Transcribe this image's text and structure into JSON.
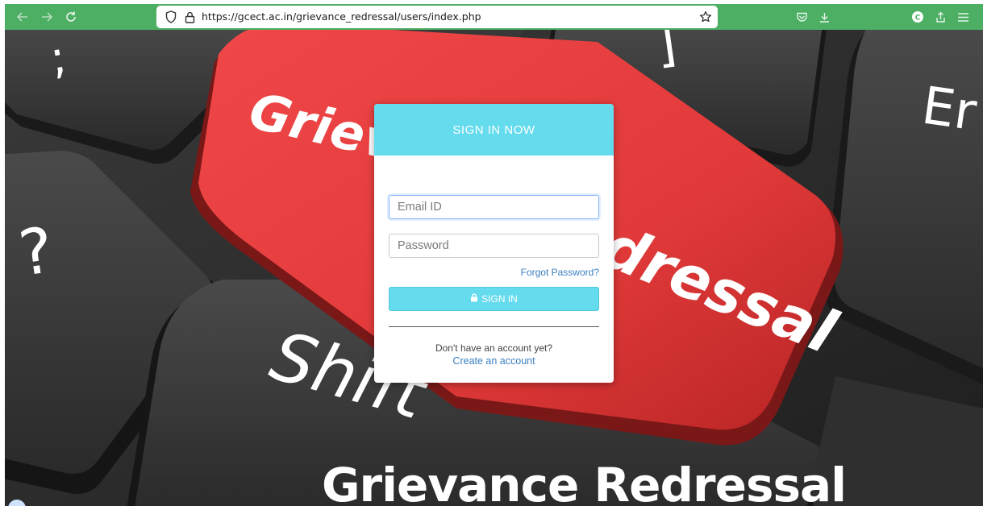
{
  "browser": {
    "url": "https://gcect.ac.in/grievance_redressal/users/index.php",
    "icons": [
      "back-icon",
      "forward-icon",
      "reload-icon",
      "shield-icon",
      "lock-icon",
      "bookmark-star-icon",
      "pocket-icon",
      "download-icon",
      "profile-icon",
      "share-icon",
      "menu-icon"
    ]
  },
  "background": {
    "key_labels": [
      ";",
      "]",
      "Er",
      "?",
      "Shift"
    ],
    "big_key_text": [
      "Grievance",
      "Redressal"
    ],
    "banner": "Grievance Redressal"
  },
  "login": {
    "title": "SIGN IN NOW",
    "email_placeholder": "Email ID",
    "password_placeholder": "Password",
    "forgot_link": "Forgot Password?",
    "signin_button": "SIGN IN",
    "no_account_text": "Don't have an account yet?",
    "create_account_link": "Create an account"
  },
  "colors": {
    "toolbar": "#4caf64",
    "card_header": "#65dbee",
    "signin_button": "#65dbee",
    "link": "#3a7fbf",
    "big_key": "#e84a4a"
  }
}
